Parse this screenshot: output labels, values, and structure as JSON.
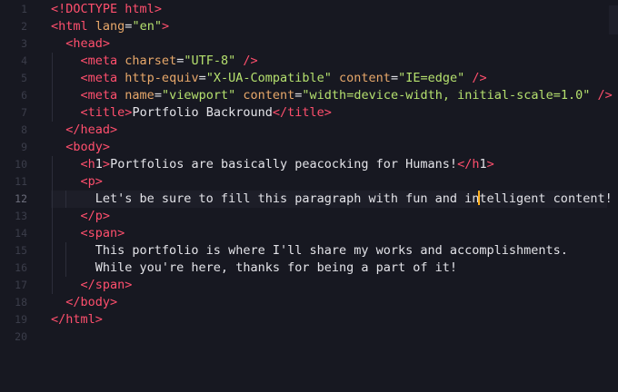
{
  "editor": {
    "line_numbers": [
      "1",
      "2",
      "3",
      "4",
      "5",
      "6",
      "7",
      "8",
      "9",
      "10",
      "11",
      "12",
      "13",
      "14",
      "15",
      "16",
      "17",
      "18",
      "19",
      "20"
    ],
    "current_line": 12,
    "lines": [
      "<!DOCTYPE html>",
      "<html lang=\"en\">",
      "  <head>",
      "    <meta charset=\"UTF-8\" />",
      "    <meta http-equiv=\"X-UA-Compatible\" content=\"IE=edge\" />",
      "    <meta name=\"viewport\" content=\"width=device-width, initial-scale=1.0\" />",
      "    <title>Portfolio Backround</title>",
      "  </head>",
      "  <body>",
      "    <h1>Portfolios are basically peacocking for Humans!</h1>",
      "    <p>",
      "      Let's be sure to fill this paragraph with fun and intelligent content!",
      "    </p>",
      "    <span>",
      "      This portfolio is where I'll share my works and accomplishments.",
      "      While you're here, thanks for being a part of it!",
      "    </span>",
      "  </body>",
      "</html>",
      ""
    ]
  },
  "colors": {
    "background": "#171821",
    "tag": "#ff4f6d",
    "attribute": "#e8a86a",
    "string": "#b5e06e",
    "text": "#e3e3e8",
    "line_number": "#3b3d4a",
    "caret": "#ffb020"
  }
}
